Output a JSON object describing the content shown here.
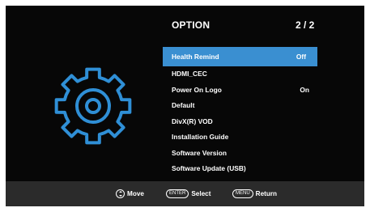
{
  "panel": {
    "title": "OPTION",
    "page": "2 / 2"
  },
  "menu": {
    "items": [
      {
        "label": "Health Remind",
        "value": "Off",
        "selected": true
      },
      {
        "label": "HDMI_CEC",
        "value": ""
      },
      {
        "label": "Power On Logo",
        "value": "On"
      },
      {
        "label": "Default",
        "value": ""
      },
      {
        "label": "DivX(R) VOD",
        "value": ""
      },
      {
        "label": "Installation Guide",
        "value": ""
      },
      {
        "label": "Software Version",
        "value": ""
      },
      {
        "label": "Software Update (USB)",
        "value": ""
      }
    ]
  },
  "footer": {
    "move_label": "Move",
    "enter_key": "ENTER",
    "select_label": "Select",
    "menu_key": "MENU",
    "return_label": "Return"
  },
  "icons": {
    "settings": "gear-icon",
    "navigate": "dpad-icon"
  },
  "colors": {
    "background": "#070707",
    "highlight": "#3a8fd1",
    "gear": "#2f8fd6",
    "footer": "#2b2b2b",
    "text": "#ffffff"
  }
}
